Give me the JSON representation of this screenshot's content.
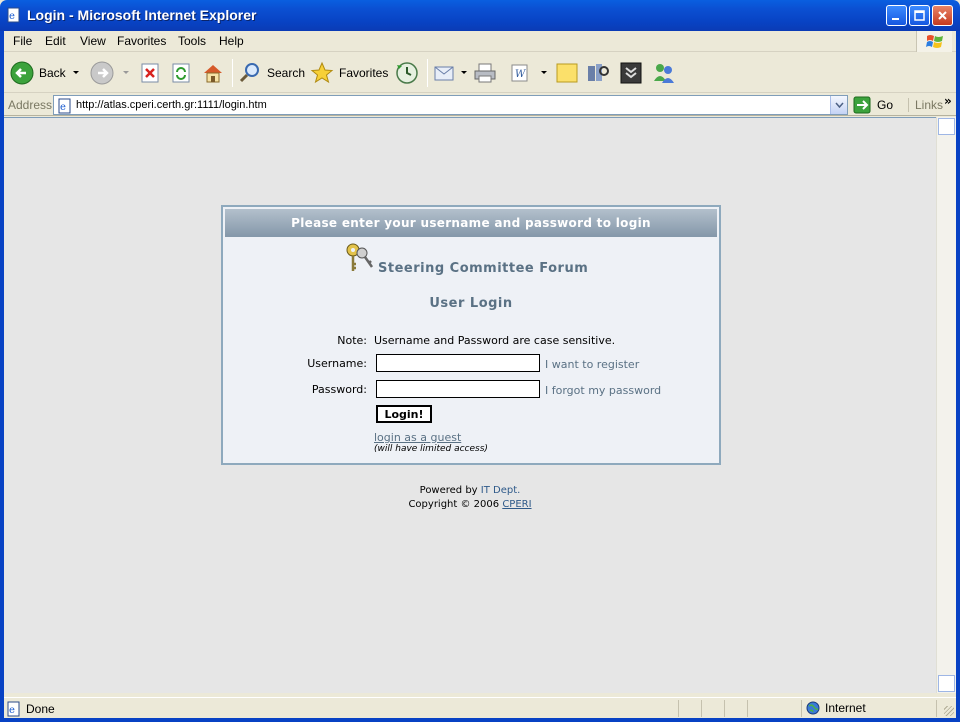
{
  "window": {
    "title": "Login - Microsoft Internet Explorer"
  },
  "menu": {
    "file": "File",
    "edit": "Edit",
    "view": "View",
    "favorites": "Favorites",
    "tools": "Tools",
    "help": "Help"
  },
  "toolbar": {
    "back_label": "Back",
    "search_label": "Search",
    "favorites_label": "Favorites"
  },
  "address": {
    "label": "Address",
    "url": "http://atlas.cperi.certh.gr:1111/login.htm",
    "go_label": "Go",
    "links_label": "Links"
  },
  "login": {
    "header": "Please enter your username and password to login",
    "forum_title": "Steering Committee Forum",
    "login_title": "User Login",
    "note_label": "Note:",
    "note_text": "Username and Password are case sensitive.",
    "username_label": "Username:",
    "username_value": "",
    "password_label": "Password:",
    "password_value": "",
    "register_link": "I want to register",
    "forgot_link": "I forgot my password",
    "login_button": "Login!",
    "guest_link": "login as a guest",
    "guest_note": "(will have limited access)"
  },
  "footer": {
    "powered_by": "Powered by",
    "it_dept": "IT Dept.",
    "copyright": "Copyright © 2006",
    "cperi": "CPERI"
  },
  "status": {
    "text": "Done",
    "zone": "Internet"
  },
  "colors": {
    "titlebar": "#0b4fd2",
    "panel_header": "#8497a9",
    "panel_bg": "#eef1f6",
    "accent_text": "#5a7184",
    "page_bg": "#e6e6e6"
  }
}
